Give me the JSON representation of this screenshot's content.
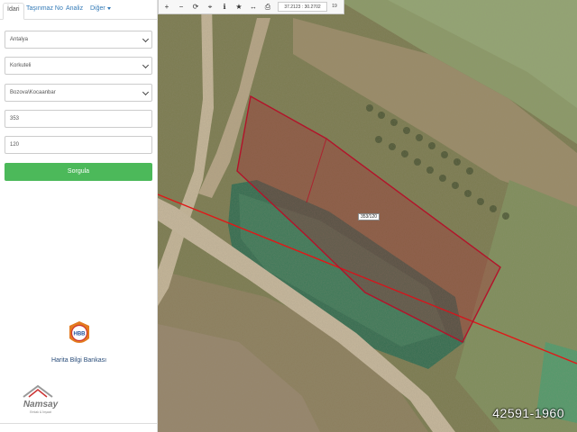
{
  "tabs": [
    {
      "label": "İdari"
    },
    {
      "label": "Taşınmaz No"
    },
    {
      "label": "Analiz"
    },
    {
      "label": "Diğer"
    }
  ],
  "form": {
    "province": "Antalya",
    "district": "Korkuteli",
    "neighborhood": "Bozova\\Kocaanbar",
    "block": "353",
    "parcel": "120",
    "submit_label": "Sorgula"
  },
  "branding": {
    "hbb_logo_text": "HBB",
    "hbb_caption": "Harita Bilgi Bankası",
    "namsay_text": "Namsay",
    "namsay_subtext": "Emlak & İnşaat"
  },
  "toolbar": {
    "coordinates": "37.2123 : 30.2702",
    "zoom_level": "19"
  },
  "map": {
    "parcel_label": "353/120",
    "listing_id": "42591-1960",
    "parcel_color": "#b3132a",
    "boundary_line_color": "#e01818"
  }
}
